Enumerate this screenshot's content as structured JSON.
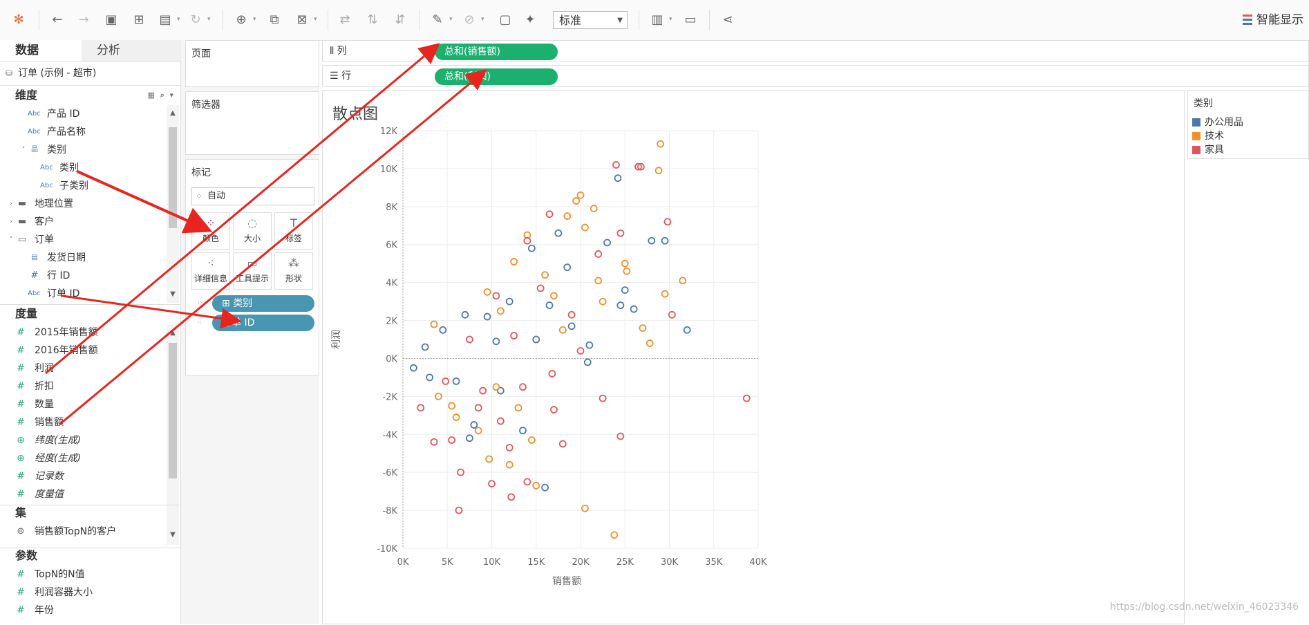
{
  "toolbar": {
    "icons": [
      "tableau-logo-icon",
      "back-icon",
      "forward-icon",
      "save-icon",
      "new-datasource-icon",
      "pause-icon",
      "refresh-icon",
      "new-worksheet-icon",
      "duplicate-icon",
      "clear-icon",
      "swap-icon",
      "sort-asc-icon",
      "sort-desc-icon",
      "highlight-icon",
      "group-icon",
      "label-icon",
      "pin-icon",
      "chart-size-icon",
      "presentation-icon",
      "share-icon"
    ],
    "fit_select": "标准",
    "show_me": "智能显示"
  },
  "left_panel": {
    "tab_data": "数据",
    "tab_analysis": "分析",
    "datasource": "订单 (示例 - 超市)",
    "dimensions_title": "维度",
    "dimensions": [
      {
        "icon": "Abc",
        "label": "产品 ID"
      },
      {
        "icon": "Abc",
        "label": "产品名称"
      },
      {
        "icon": "hierarchy",
        "label": "类别"
      },
      {
        "icon": "Abc",
        "label": "类别"
      },
      {
        "icon": "Abc",
        "label": "子类别"
      },
      {
        "icon": "folder",
        "label": "地理位置"
      },
      {
        "icon": "folder",
        "label": "客户"
      },
      {
        "icon": "folder-open",
        "label": "订单"
      },
      {
        "icon": "date",
        "label": "发货日期"
      },
      {
        "icon": "#",
        "label": "行 ID"
      },
      {
        "icon": "Abc",
        "label": "订单 ID"
      }
    ],
    "measures_title": "度量",
    "measures": [
      {
        "label": "2015年销售额"
      },
      {
        "label": "2016年销售额"
      },
      {
        "label": "利润"
      },
      {
        "label": "折扣"
      },
      {
        "label": "数量"
      },
      {
        "label": "销售额"
      },
      {
        "label": "纬度(生成)"
      },
      {
        "label": "经度(生成)"
      },
      {
        "label": "记录数"
      },
      {
        "label": "度量值"
      }
    ],
    "sets_title": "集",
    "sets": [
      {
        "label": "销售额TopN的客户"
      }
    ],
    "params_title": "参数",
    "params": [
      {
        "label": "TopN的N值"
      },
      {
        "label": "利润容器大小"
      },
      {
        "label": "年份"
      }
    ]
  },
  "cards": {
    "pages": "页面",
    "filters": "筛选器",
    "marks": "标记",
    "mark_type": "自动",
    "buttons": [
      "颜色",
      "大小",
      "标签",
      "详细信息",
      "工具提示",
      "形状"
    ],
    "pill_color": "类别",
    "pill_detail": "订单 ID"
  },
  "shelves": {
    "columns_label": "列",
    "columns_pill": "总和(销售额)",
    "rows_label": "行",
    "rows_pill": "总和(利润)"
  },
  "viz": {
    "title": "散点图"
  },
  "legend": {
    "title": "类别",
    "items": [
      {
        "label": "办公用品",
        "color": "#4e79a7"
      },
      {
        "label": "技术",
        "color": "#f28e2b"
      },
      {
        "label": "家具",
        "color": "#e15759"
      }
    ]
  },
  "chart_data": {
    "type": "scatter",
    "xlabel": "销售额",
    "ylabel": "利润",
    "xlim": [
      0,
      40000
    ],
    "ylim": [
      -10000,
      12000
    ],
    "x_ticks": [
      "0K",
      "5K",
      "10K",
      "15K",
      "20K",
      "25K",
      "30K",
      "35K",
      "40K"
    ],
    "y_ticks": [
      "12K",
      "10K",
      "8K",
      "6K",
      "4K",
      "2K",
      "0K",
      "-2K",
      "-4K",
      "-6K",
      "-8K",
      "-10K"
    ],
    "series": [
      {
        "name": "办公用品",
        "color": "#4e79a7",
        "points": [
          [
            24200,
            9500
          ],
          [
            28000,
            6200
          ],
          [
            29500,
            6200
          ],
          [
            23000,
            6100
          ],
          [
            25000,
            3600
          ],
          [
            24500,
            2800
          ],
          [
            26000,
            2600
          ],
          [
            32000,
            1500
          ],
          [
            21000,
            700
          ],
          [
            20800,
            -200
          ],
          [
            11000,
            -1700
          ],
          [
            8000,
            -3500
          ],
          [
            16000,
            -6800
          ],
          [
            19000,
            1700
          ],
          [
            17500,
            6600
          ],
          [
            14500,
            5800
          ],
          [
            12000,
            3000
          ],
          [
            9500,
            2200
          ],
          [
            15000,
            1000
          ],
          [
            6000,
            -1200
          ],
          [
            13500,
            -3800
          ],
          [
            7500,
            -4200
          ],
          [
            3000,
            -1000
          ],
          [
            4500,
            1500
          ],
          [
            2500,
            600
          ],
          [
            16500,
            2800
          ],
          [
            10500,
            900
          ],
          [
            1200,
            -500
          ],
          [
            7000,
            2300
          ],
          [
            18500,
            4800
          ]
        ]
      },
      {
        "name": "技术",
        "color": "#f28e2b",
        "points": [
          [
            29000,
            11300
          ],
          [
            28800,
            9900
          ],
          [
            20000,
            8600
          ],
          [
            19500,
            8300
          ],
          [
            18500,
            7500
          ],
          [
            21500,
            7900
          ],
          [
            20500,
            6900
          ],
          [
            25000,
            5000
          ],
          [
            25200,
            4600
          ],
          [
            31500,
            4100
          ],
          [
            29500,
            3400
          ],
          [
            27000,
            1600
          ],
          [
            27800,
            800
          ],
          [
            20500,
            -7900
          ],
          [
            23800,
            -9300
          ],
          [
            22000,
            4100
          ],
          [
            14000,
            6500
          ],
          [
            12500,
            5100
          ],
          [
            16000,
            4400
          ],
          [
            9500,
            3500
          ],
          [
            11000,
            2500
          ],
          [
            13000,
            -2600
          ],
          [
            14500,
            -4300
          ],
          [
            8500,
            -3800
          ],
          [
            9700,
            -5300
          ],
          [
            12000,
            -5600
          ],
          [
            15000,
            -6700
          ],
          [
            6000,
            -3100
          ],
          [
            4000,
            -2000
          ],
          [
            18000,
            1500
          ],
          [
            22500,
            3000
          ],
          [
            10500,
            -1500
          ],
          [
            5500,
            -2500
          ],
          [
            3500,
            1800
          ],
          [
            17000,
            3300
          ]
        ]
      },
      {
        "name": "家具",
        "color": "#e15759",
        "points": [
          [
            24000,
            10200
          ],
          [
            26500,
            10100
          ],
          [
            26800,
            10100
          ],
          [
            29800,
            7200
          ],
          [
            24500,
            6600
          ],
          [
            22000,
            5500
          ],
          [
            16500,
            7600
          ],
          [
            14000,
            6200
          ],
          [
            30300,
            2300
          ],
          [
            38700,
            -2100
          ],
          [
            22500,
            -2100
          ],
          [
            24500,
            -4100
          ],
          [
            18000,
            -4500
          ],
          [
            6500,
            -6000
          ],
          [
            6300,
            -8000
          ],
          [
            12200,
            -7300
          ],
          [
            14000,
            -6500
          ],
          [
            10000,
            -6600
          ],
          [
            12000,
            -4700
          ],
          [
            8500,
            -2600
          ],
          [
            5500,
            -4300
          ],
          [
            3500,
            -4400
          ],
          [
            11000,
            -3300
          ],
          [
            17000,
            -2700
          ],
          [
            13500,
            -1500
          ],
          [
            19000,
            2300
          ],
          [
            20000,
            400
          ],
          [
            7500,
            1000
          ],
          [
            9000,
            -1700
          ],
          [
            15500,
            3700
          ],
          [
            2000,
            -2600
          ],
          [
            4800,
            -1200
          ],
          [
            10500,
            3300
          ],
          [
            12500,
            1200
          ],
          [
            16800,
            -800
          ]
        ]
      }
    ]
  }
}
